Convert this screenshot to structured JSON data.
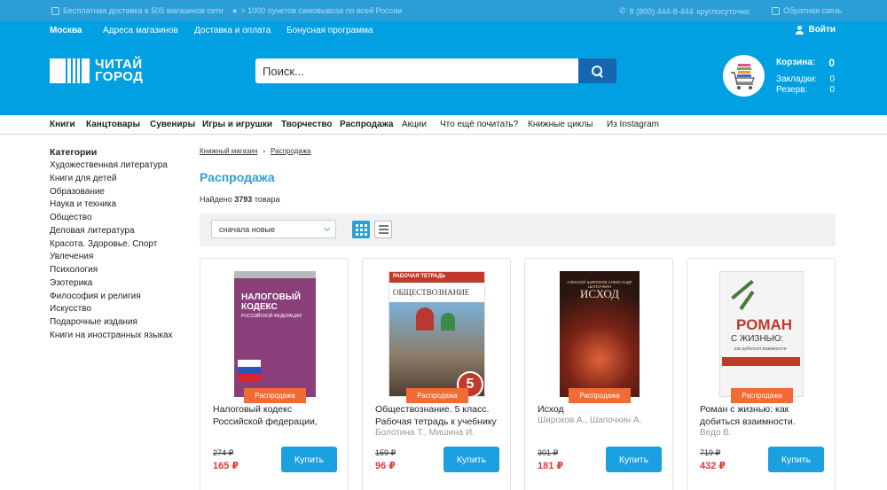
{
  "topbar": {
    "delivery": "Бесплатная доставка в 505 магазинов сети",
    "pickup": "> 1000 пунктов самовывоза по всей России",
    "phone": "8 (800) 444-8-444",
    "phone_note": "круглосуточно",
    "feedback": "Обратная связь"
  },
  "header": {
    "city": "Москва",
    "links": [
      "Адреса магазинов",
      "Доставка и оплата",
      "Бонусная программа"
    ],
    "login": "Войти",
    "logo_line1": "ЧИТАЙ",
    "logo_line2": "ГОРОД",
    "search_placeholder": "Поиск...",
    "cart_label": "Корзина:",
    "cart_count": "0",
    "bookmarks_label": "Закладки:",
    "bookmarks_count": "0",
    "reserve_label": "Резерв:",
    "reserve_count": "0"
  },
  "catnav": [
    "Книги",
    "Канцтовары",
    "Сувениры",
    "Игры и игрушки",
    "Творчество",
    "Распродажа",
    "Акции",
    "Что ещё почитать?",
    "Книжные циклы",
    "Из Instagram"
  ],
  "sidebar": {
    "heading": "Категории",
    "items": [
      "Художественная литература",
      "Книги для детей",
      "Образование",
      "Наука и техника",
      "Общество",
      "Деловая литература",
      "Красота. Здоровье. Спорт",
      "Увлечения",
      "Психология",
      "Эзотерика",
      "Философия и религия",
      "Искусство",
      "Подарочные издания",
      "Книги на иностранных языках"
    ]
  },
  "breadcrumbs": [
    "Книжный магазин",
    "›",
    "Распродажа"
  ],
  "page_title": "Распродажа",
  "found": {
    "prefix": "Найдено",
    "count": "3793",
    "suffix": "товара"
  },
  "sort": {
    "selected": "сначала новые"
  },
  "products": [
    {
      "title": "Налоговый кодекс Российской федерации,",
      "author": "",
      "old_price": "274 ₽",
      "price": "165 ₽",
      "badge": "Распродажа",
      "buy": "Купить",
      "cover": {
        "top": "НАЛОГОВЫЙ КОДЕКС",
        "sub": "РОССИЙСКОЙ ФЕДЕРАЦИИ",
        "bg": "#8a3f7a"
      }
    },
    {
      "title": "Обществознание. 5 класс. Рабочая тетрадь к учебнику",
      "author": "Болотина Т., Мишина И.",
      "old_price": "159 ₽",
      "price": "96 ₽",
      "badge": "Распродажа",
      "buy": "Купить",
      "cover": {
        "top": "РАБОЧАЯ ТЕТРАДЬ",
        "sub": "ОБЩЕСТВОЗНАНИЕ",
        "num": "5",
        "bg": "#c0392b"
      }
    },
    {
      "title": "Исход",
      "author": "Широков А., Шапочкин А.",
      "old_price": "301 ₽",
      "price": "181 ₽",
      "badge": "Распродажа",
      "buy": "Купить",
      "cover": {
        "top": "АЛЕКСЕЙ ШИРОКОВ АЛЕКСАНДР ШАПОЧКИН",
        "sub": "ИСХОД",
        "bg": "#2a1510"
      }
    },
    {
      "title": "Роман с жизнью: как добиться взаимности.",
      "author": "Ведо В.",
      "old_price": "719 ₽",
      "price": "432 ₽",
      "badge": "Распродажа",
      "buy": "Купить",
      "cover": {
        "top": "РОМАН",
        "sub": "С ЖИЗНЬЮ:",
        "note": "как добиться взаимности",
        "bg": "#f4f4f4"
      }
    }
  ],
  "colors": {
    "brand": "#00a0e3",
    "sale": "#f26a35",
    "price": "#e53935",
    "buy": "#1aa0e0"
  }
}
